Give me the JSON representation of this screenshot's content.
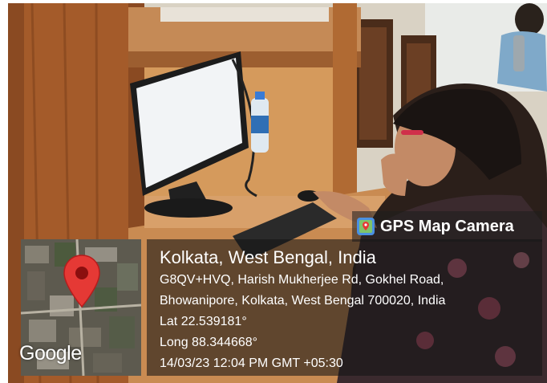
{
  "overlay": {
    "brand_label": "GPS Map Camera",
    "location_title": "Kolkata, West Bengal, India",
    "address_line_1": "G8QV+HVQ, Harish Mukherjee Rd, Gokhel Road,",
    "address_line_2": "Bhowanipore, Kolkata, West Bengal 700020, India",
    "latitude": "Lat 22.539181°",
    "longitude": "Long 88.344668°",
    "timestamp": "14/03/23 12:04 PM GMT +05:30"
  },
  "map_thumbnail": {
    "logo_text": "Google",
    "marker_icon": "map-pin-icon",
    "marker_color": "#e53935"
  },
  "brand_icon": "camera-map-icon",
  "colors": {
    "overlay_bg": "#1e1e1e",
    "text": "#ffffff"
  }
}
